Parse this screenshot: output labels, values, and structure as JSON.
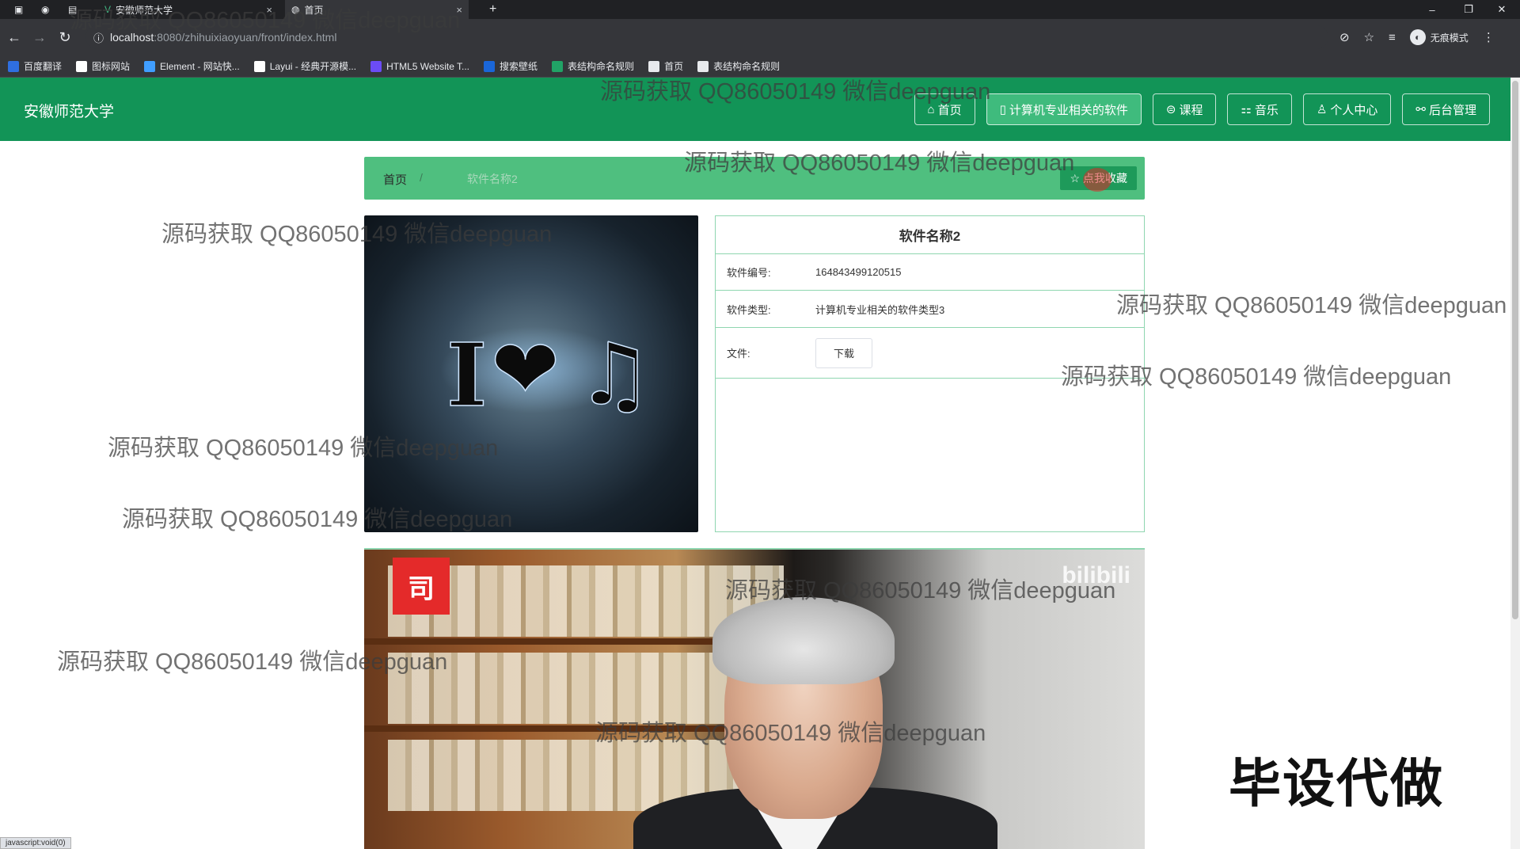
{
  "browser": {
    "tabs": [
      {
        "label": "安徽师范大学",
        "icon": "vue-logo-icon"
      },
      {
        "label": "首页",
        "icon": "globe-icon"
      }
    ],
    "url_host": "localhost",
    "url_path": ":8080/zhihuixiaoyuan/front/index.html",
    "profile_label": "无痕模式",
    "bookmarks": [
      {
        "label": "百度翻译",
        "color": "#2f6fe0"
      },
      {
        "label": "图标网站",
        "color": "#ffffff"
      },
      {
        "label": "Element - 网站快...",
        "color": "#409eff"
      },
      {
        "label": "Layui - 经典开源模...",
        "color": "#ffffff"
      },
      {
        "label": "HTML5 Website T...",
        "color": "#6b4cf6"
      },
      {
        "label": "搜索壁纸",
        "color": "#1a66d8"
      },
      {
        "label": "表结构命名规则",
        "color": "#21a366"
      },
      {
        "label": "首页",
        "color": "#e8eaed"
      },
      {
        "label": "表结构命名规则",
        "color": "#e8eaed"
      }
    ],
    "status_text": "javascript:void(0)"
  },
  "header": {
    "brand": "安徽师范大学",
    "nav": [
      {
        "icon": "home-icon",
        "glyph": "⌂",
        "label": "首页",
        "active": false
      },
      {
        "icon": "software-icon",
        "glyph": "▯",
        "label": "计算机专业相关的软件",
        "active": true
      },
      {
        "icon": "course-icon",
        "glyph": "⊜",
        "label": "课程",
        "active": false
      },
      {
        "icon": "music-icon",
        "glyph": "⚏",
        "label": "音乐",
        "active": false
      },
      {
        "icon": "user-icon",
        "glyph": "♙",
        "label": "个人中心",
        "active": false
      },
      {
        "icon": "link-icon",
        "glyph": "⚯",
        "label": "后台管理",
        "active": false
      }
    ]
  },
  "breadcrumb": {
    "home": "首页",
    "separator": "/",
    "current": "软件名称2",
    "favorite_label": "点我收藏",
    "favorite_icon": "star-icon"
  },
  "detail": {
    "title": "软件名称2",
    "rows": [
      {
        "key": "软件编号:",
        "value": "164843499120515"
      },
      {
        "key": "软件类型:",
        "value": "计算机专业相关的软件类型3"
      }
    ],
    "file_label": "文件:",
    "download_label": "下载"
  },
  "cover": {
    "text_i": "I",
    "text_heart": "❤",
    "text_note": "♫"
  },
  "video": {
    "badge": "司",
    "brand": "bilibili"
  },
  "promo_text": "毕设代做",
  "watermark": "源码获取 QQ86050149 微信deepguan",
  "colors": {
    "header_green": "#129457",
    "crumb_green": "#4fbf7f",
    "border_green": "#8fd6b0"
  }
}
